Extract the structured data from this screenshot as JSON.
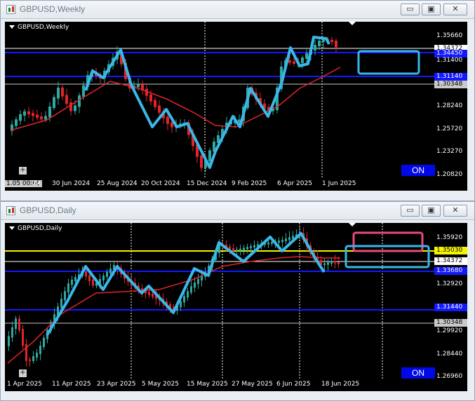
{
  "weekly": {
    "title": "GBPUSD,Weekly",
    "chart_label": "GBPUSD,Weekly",
    "window_buttons": {
      "minimize": "▭",
      "maximize": "▣",
      "close": "✕"
    },
    "price_labels": [
      "1.35660",
      "1.34372",
      "1.34450",
      "1.31400",
      "1.30348",
      "1.28240",
      "1.25720",
      "1.23270",
      "1.20820",
      "1.31140"
    ],
    "date_labels": [
      "1.05 00:00",
      "24",
      "30 Jun 2024",
      "25 Aug 2024",
      "20 Oct 2024",
      "15 Dec 2024",
      "9 Feb 2025",
      "6 Apr 2025",
      "1 Jun 2025"
    ],
    "on_label": "ON",
    "plus_label": "+",
    "colors": {
      "bull": "#2fa9a0",
      "bear": "#e3242b",
      "ma": "#e3242b",
      "zigzag": "#39b8e8",
      "hline": "#1219ff",
      "rect": "#39b8e8",
      "bg": "#000000"
    }
  },
  "daily": {
    "title": "GBPUSD,Daily",
    "chart_label": "GBPUSD,Daily",
    "window_buttons": {
      "minimize": "▭",
      "maximize": "▣",
      "close": "✕"
    },
    "price_labels": [
      "1.35920",
      "1.35030",
      "1.34372",
      "1.33680",
      "1.32920",
      "1.31440",
      "1.30348",
      "1.29920",
      "1.28440",
      "1.26960"
    ],
    "date_labels": [
      "1 Apr 2025",
      "11 Apr 2025",
      "23 Apr 2025",
      "5 May 2025",
      "15 May 2025",
      "27 May 2025",
      "6 Jun 2025",
      "18 Jun 2025"
    ],
    "on_label": "ON",
    "plus_label": "+",
    "colors": {
      "bull": "#2fa9a0",
      "bear": "#e3242b",
      "ma": "#e3242b",
      "zigzag": "#39b8e8",
      "hline": "#1219ff",
      "yline": "#f4f400",
      "rect_blue": "#39b8e8",
      "rect_pink": "#e94a7a",
      "bg": "#000000"
    }
  }
}
